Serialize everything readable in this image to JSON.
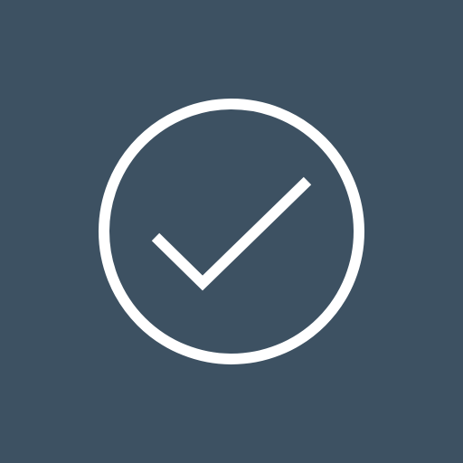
{
  "background_color": "#3d5162",
  "icon": {
    "name": "check-circle-icon",
    "stroke_color": "#ffffff"
  }
}
